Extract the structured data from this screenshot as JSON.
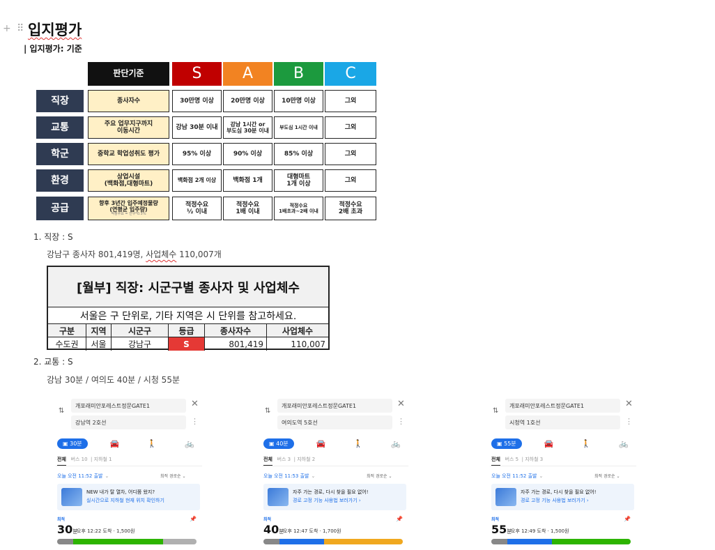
{
  "header": {
    "handle_glyph": "+ ⠿",
    "title": "입지평가",
    "subtitle": "| 입지평가: 기준"
  },
  "criteria_table": {
    "header_criteria": "판단기준",
    "grades": [
      {
        "label": "S",
        "color": "#c00000"
      },
      {
        "label": "A",
        "color": "#f28322"
      },
      {
        "label": "B",
        "color": "#1c9a3e"
      },
      {
        "label": "C",
        "color": "#1aa7e6"
      }
    ],
    "rows": [
      {
        "label": "직장",
        "criteria": "종사자수",
        "values": [
          "30만명 이상",
          "20만명 이상",
          "10만명 이상",
          "그외"
        ]
      },
      {
        "label": "교통",
        "criteria": "주요 업무지구까지\n이동시간",
        "values": [
          "강남 30분 이내",
          "강남 1시간 or\n부도심 30분 이내",
          "부도심 1시간 이내",
          "그외"
        ]
      },
      {
        "label": "학군",
        "criteria": "중학교 학업성취도 평가",
        "values": [
          "95% 이상",
          "90% 이상",
          "85% 이상",
          "그외"
        ]
      },
      {
        "label": "환경",
        "criteria": "상업시설\n(백화점,대형마트)",
        "values": [
          "백화점 2개 이상",
          "백화점 1개",
          "대형마트\n1개 이상",
          "그외"
        ]
      },
      {
        "label": "공급",
        "criteria": "향후 3년간 입주예정물량\n(연평균 입주량)",
        "criteria_note": "적정수요 = 인구*0.5%",
        "values": [
          "적정수요\n½ 이내",
          "적정수요\n1배 이내",
          "적정수요\n1배초과~2배 이내",
          "적정수요\n2배 초과"
        ]
      }
    ]
  },
  "list": [
    {
      "label": "1.  직장 : S",
      "text": "강남구 종사자 801,419명, ",
      "text_flag": "사업체수",
      "text_end": " 110,007개"
    },
    {
      "label": "2.  교통 : S",
      "text": "강남 30분 / 여의도 40분 / 시청 55분"
    }
  ],
  "worker_table": {
    "title": "[월부] 직장: 시군구별 종사자 및 사업체수",
    "note": "서울은 구 단위로, 기타 지역은 시 단위를 참고하세요.",
    "headers": [
      "구분",
      "지역",
      "시군구",
      "등급",
      "종사자수",
      "사업체수"
    ],
    "row": [
      "수도권",
      "서울",
      "강남구",
      "S",
      "801,419",
      "110,007"
    ],
    "grade_color": "#e53935"
  },
  "transit_cards": [
    {
      "from": "개포래미안포레스트정문GATE1",
      "to": "강남역 2호선",
      "mode_bus": "30분",
      "tabs": [
        "전체",
        "버스 10",
        "지하철 1"
      ],
      "depart": "오늘 오전 11:52 출발",
      "sort": "최적 경로순",
      "banner_l1": "NEW 내가 탈 열차, 어디쯤 왔지?",
      "banner_l2": "실시간으로 지하철 현재 위치 확인하기",
      "fastest": "최적",
      "duration": "30",
      "duration_unit": "분",
      "arrive": "오후 12:22 도착 · 1,500원"
    },
    {
      "from": "개포래미안포레스트정문GATE1",
      "to": "여의도역 5호선",
      "mode_bus": "40분",
      "tabs": [
        "전체",
        "버스 3",
        "지하철 2"
      ],
      "depart": "오늘 오전 11:53 출발",
      "sort": "최적 경로순",
      "banner_l1": "자주 가는 경로, 다시 찾을 필요 없어!",
      "banner_l2": "경로 고정 기능 사용법 보러가기 ›",
      "fastest": "최적",
      "duration": "40",
      "duration_unit": "분",
      "arrive": "오후 12:47 도착 · 1,700원"
    },
    {
      "from": "개포래미안포레스트정문GATE1",
      "to": "시청역 1호선",
      "mode_bus": "55분",
      "tabs": [
        "전체",
        "버스 5",
        "지하철 3"
      ],
      "depart": "오늘 오전 11:52 출발",
      "sort": "최적 경로순",
      "banner_l1": "자주 가는 경로, 다시 찾을 필요 없어!",
      "banner_l2": "경로 고정 기능 사용법 보러가기 ›",
      "fastest": "최적",
      "duration": "55",
      "duration_unit": "분",
      "arrive": "오후 12:49 도착 · 1,500원"
    }
  ]
}
